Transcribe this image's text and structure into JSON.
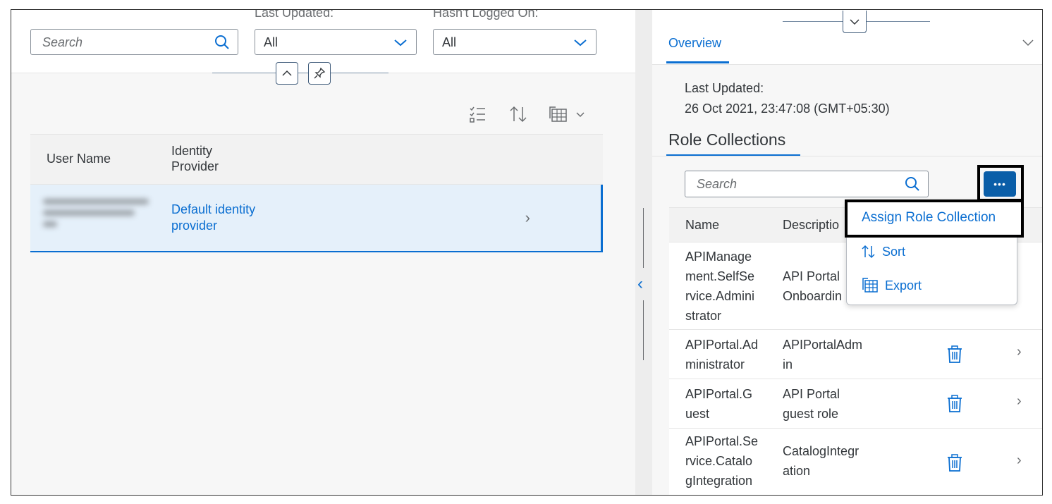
{
  "filters": {
    "search_placeholder": "Search",
    "last_updated_label": "Last Updated:",
    "last_updated_value": "All",
    "hasnt_logged_label": "Hasn't Logged On:",
    "hasnt_logged_value": "All"
  },
  "users_table": {
    "col_user_name": "User Name",
    "col_identity_provider_line1": "Identity",
    "col_identity_provider_line2": "Provider",
    "row": {
      "identity_provider_line1": "Default identity",
      "identity_provider_line2": "provider"
    }
  },
  "detail": {
    "tab_overview": "Overview",
    "last_updated_label": "Last Updated:",
    "last_updated_value": "26 Oct 2021, 23:47:08 (GMT+05:30)",
    "section_title": "Role Collections",
    "search_placeholder": "Search",
    "more_label": "•••",
    "col_name": "Name",
    "col_description": "Descriptio",
    "rows": [
      {
        "name": [
          "APIManage",
          "ment.SelfSe",
          "rvice.Admini",
          "strator"
        ],
        "description": [
          "API Portal",
          "Onboardin"
        ]
      },
      {
        "name": [
          "APIPortal.Ad",
          "ministrator"
        ],
        "description": [
          "APIPortalAdm",
          "in"
        ]
      },
      {
        "name": [
          "APIPortal.G",
          "uest"
        ],
        "description": [
          "API Portal",
          "guest role"
        ]
      },
      {
        "name": [
          "APIPortal.Se",
          "rvice.Catalo",
          "gIntegration"
        ],
        "description": [
          "CatalogIntegr",
          "ation"
        ]
      }
    ]
  },
  "menu": {
    "assign": "Assign Role Collection",
    "sort": "Sort",
    "export": "Export"
  },
  "colors": {
    "accent": "#0a6ed1",
    "selected_row": "#e5f0fa",
    "button_bg": "#0a5ea8"
  }
}
